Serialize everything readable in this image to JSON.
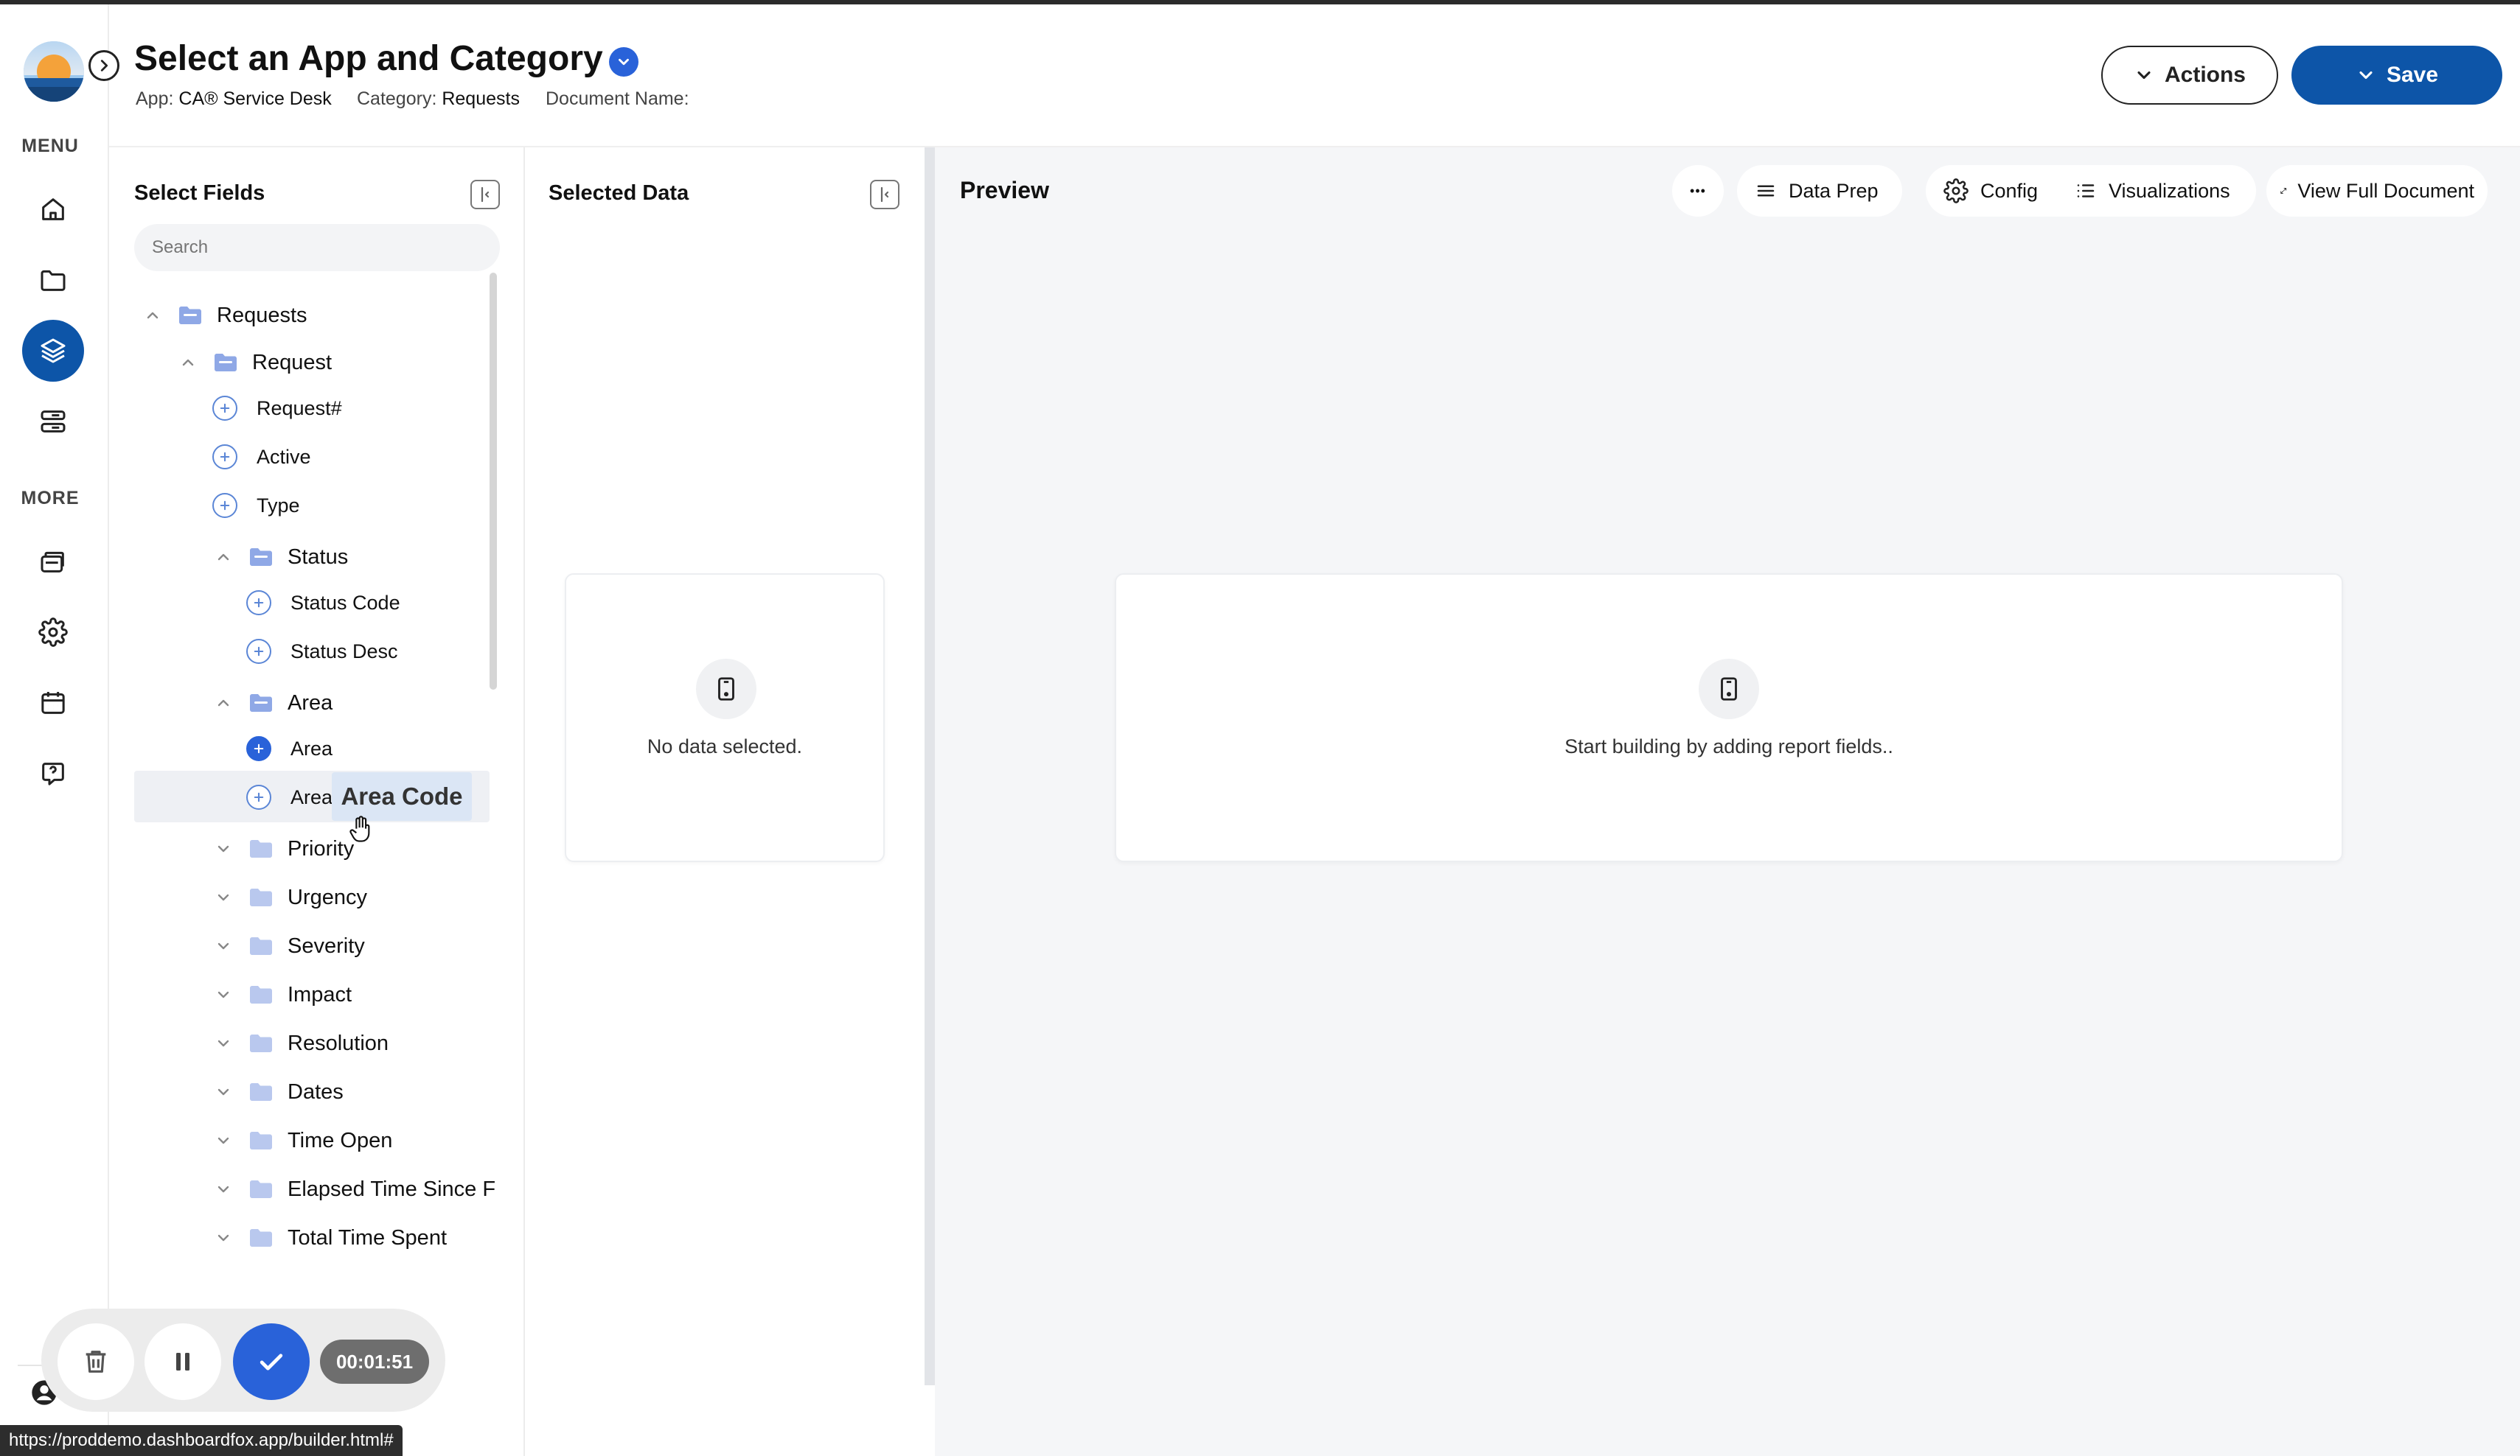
{
  "header": {
    "title": "Select an App and Category",
    "app_label": "App:",
    "app_value": "CA® Service Desk",
    "category_label": "Category:",
    "category_value": "Requests",
    "document_name_label": "Document Name:",
    "actions_label": "Actions",
    "save_label": "Save"
  },
  "rail": {
    "menu_label": "MENU",
    "more_label": "MORE",
    "menu_icons": [
      "home-icon",
      "folder-icon",
      "layers-icon",
      "database-icon"
    ],
    "more_icons": [
      "cards-icon",
      "gear-icon",
      "calendar-icon",
      "help-icon"
    ],
    "active_icon": "layers-icon"
  },
  "select_fields": {
    "title": "Select Fields",
    "search_placeholder": "Search",
    "tree": [
      {
        "label": "Requests",
        "kind": "folder",
        "expanded": true,
        "level": 0
      },
      {
        "label": "Request",
        "kind": "folder",
        "expanded": true,
        "level": 1
      },
      {
        "label": "Request#",
        "kind": "field",
        "level": 2
      },
      {
        "label": "Active",
        "kind": "field",
        "level": 2
      },
      {
        "label": "Type",
        "kind": "field",
        "level": 2
      },
      {
        "label": "Status",
        "kind": "folder",
        "expanded": true,
        "level": 2
      },
      {
        "label": "Status Code",
        "kind": "field",
        "level": 3
      },
      {
        "label": "Status Desc",
        "kind": "field",
        "level": 3
      },
      {
        "label": "Area",
        "kind": "folder",
        "expanded": true,
        "level": 2
      },
      {
        "label": "Area",
        "kind": "field",
        "level": 3,
        "hovered": true
      },
      {
        "label": "Area Desc",
        "kind": "field",
        "level": 3
      },
      {
        "label": "Priority",
        "kind": "folder",
        "expanded": false,
        "level": 2
      },
      {
        "label": "Urgency",
        "kind": "folder",
        "expanded": false,
        "level": 2
      },
      {
        "label": "Severity",
        "kind": "folder",
        "expanded": false,
        "level": 2
      },
      {
        "label": "Impact",
        "kind": "folder",
        "expanded": false,
        "level": 2
      },
      {
        "label": "Resolution",
        "kind": "folder",
        "expanded": false,
        "level": 2
      },
      {
        "label": "Dates",
        "kind": "folder",
        "expanded": false,
        "level": 2
      },
      {
        "label": "Time Open",
        "kind": "folder",
        "expanded": false,
        "level": 2
      },
      {
        "label": "Elapsed Time Since F",
        "kind": "folder",
        "expanded": false,
        "level": 2
      },
      {
        "label": "Total Time Spent",
        "kind": "folder",
        "expanded": false,
        "level": 2
      }
    ],
    "drag_label": "Area Code"
  },
  "selected_data": {
    "title": "Selected Data",
    "empty_text": "No data selected."
  },
  "preview": {
    "title": "Preview",
    "toolbar": {
      "more_label": "•••",
      "data_prep_label": "Data Prep",
      "config_label": "Config",
      "visualizations_label": "Visualizations",
      "view_full_document_label": "View Full Document"
    },
    "empty_text": "Start building by adding report fields.."
  },
  "recorder": {
    "timer": "00:01:51"
  },
  "status_bar": {
    "url": "https://proddemo.dashboardfox.app/builder.html#"
  },
  "colors": {
    "primary": "#0d55a8",
    "accent_blue": "#2962d9",
    "folder": "#8fa8e6",
    "panel_bg": "#f5f6f8"
  }
}
